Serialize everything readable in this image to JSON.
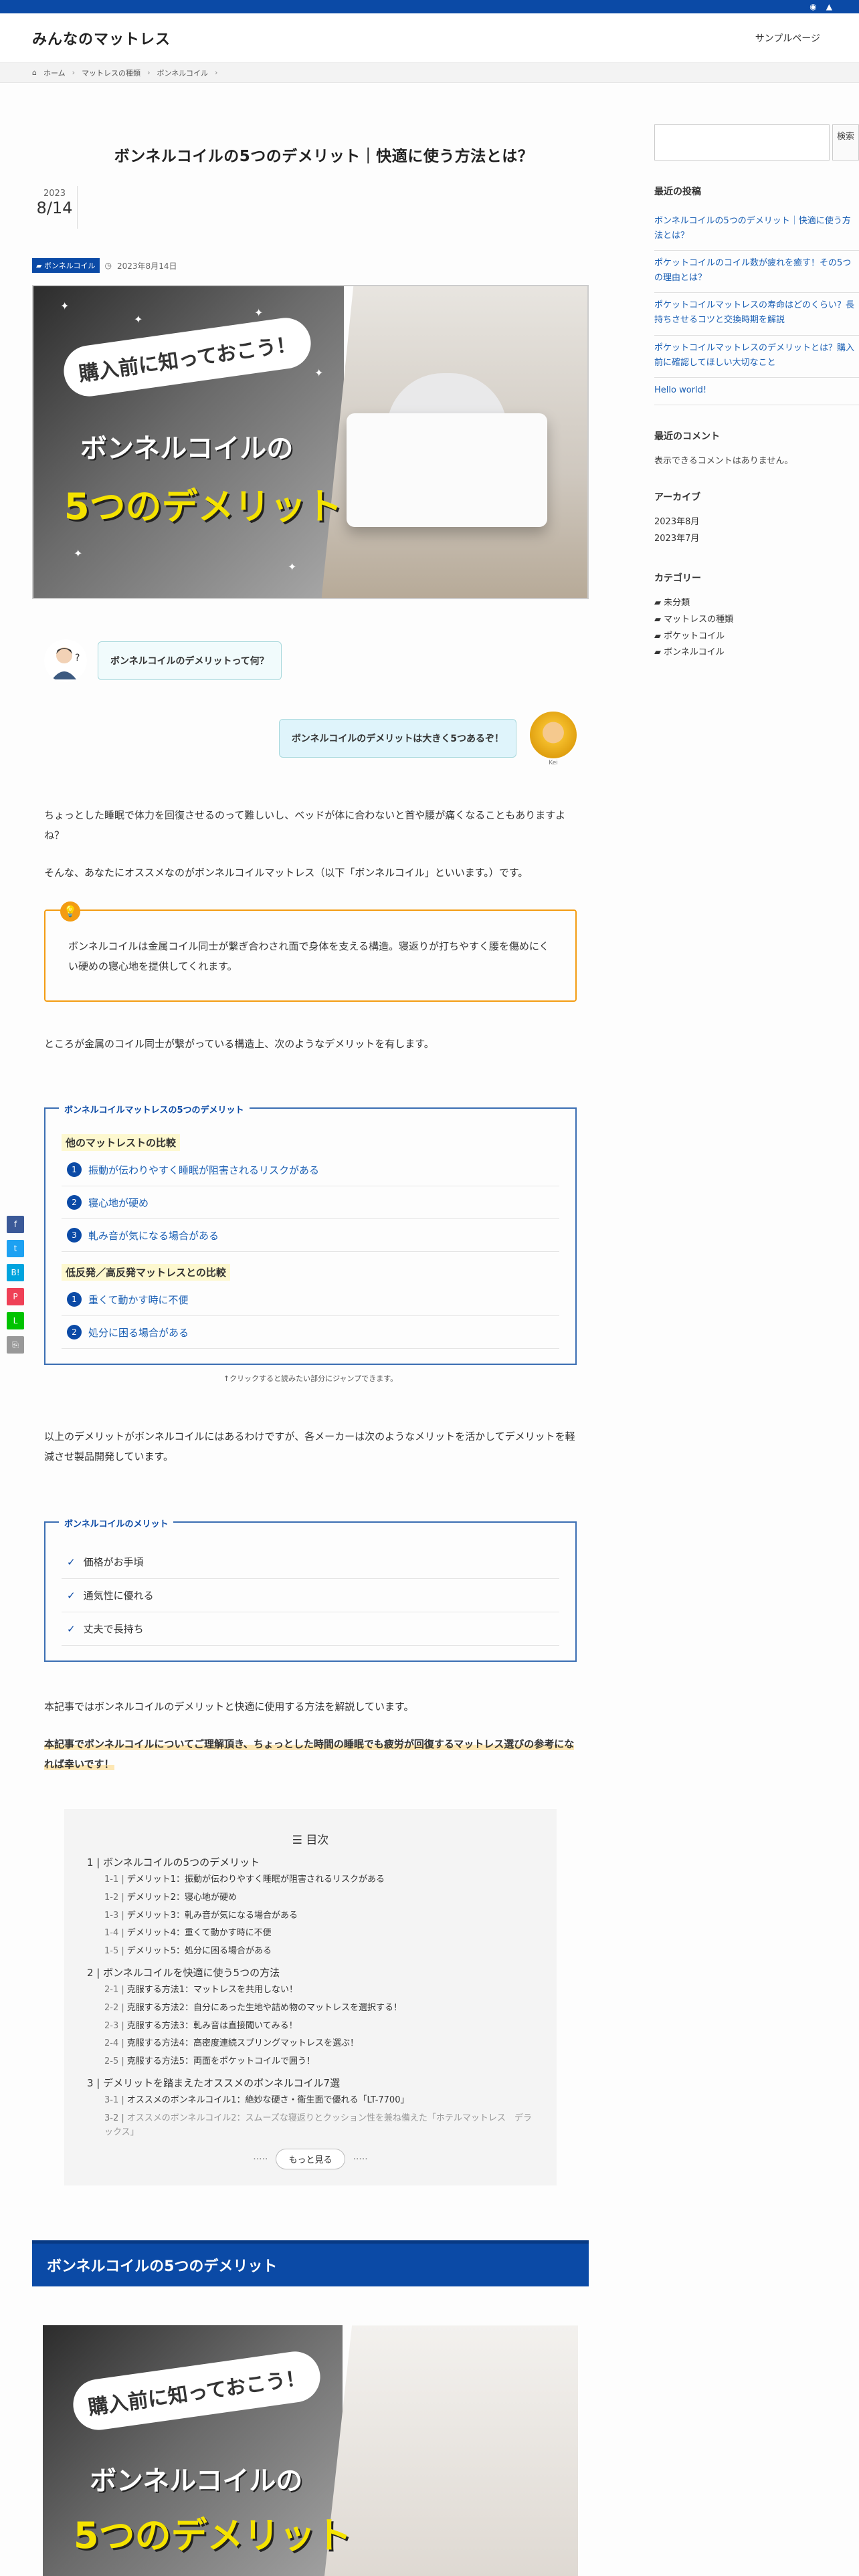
{
  "topbar": {
    "rss_icon": "rss-icon",
    "feedly_icon": "feedly-icon"
  },
  "header": {
    "site_title": "みんなのマットレス",
    "nav_item": "サンプルページ"
  },
  "breadcrumb": {
    "home": "ホーム",
    "cat1": "マットレスの種類",
    "cat2": "ボンネルコイル"
  },
  "post": {
    "title": "ボンネルコイルの5つのデメリット｜快適に使う方法とは？",
    "date_year": "2023",
    "date_md": "8/14",
    "category": "ボンネルコイル",
    "published": "2023年8月14日"
  },
  "eyecatch": {
    "sub": "購入前に知っておこう！",
    "line1": "ボンネルコイルの",
    "line2": "5つのデメリット"
  },
  "chat": {
    "q": "ボンネルコイルのデメリットって何？",
    "a": "ボンネルコイルのデメリットは大きく5つあるぞ！",
    "name": "Kei"
  },
  "body": {
    "p1": "ちょっとした睡眠で体力を回復させるのって難しいし、ベッドが体に合わないと首や腰が痛くなることもありますよね？",
    "p2": "そんな、あなたにオススメなのがボンネルコイルマットレス（以下「ボンネルコイル」といいます。）です。",
    "note": "ボンネルコイルは金属コイル同士が繋ぎ合わされ面で身体を支える構造。寝返りが打ちやすく腰を傷めにくい硬めの寝心地を提供してくれます。",
    "p3": "ところが金属のコイル同士が繋がっている構造上、次のようなデメリットを有します。",
    "p4": "以上のデメリットがボンネルコイルにはあるわけですが、各メーカーは次のようなメリットを活かしてデメリットを軽減させ製品開発しています。",
    "p5": "本記事ではボンネルコイルのデメリットと快適に使用する方法を解説しています。",
    "p6": "本記事でボンネルコイルについてご理解頂き、ちょっとした時間の睡眠でも疲労が回復するマットレス選びの参考になれば幸いです！"
  },
  "demerit_box": {
    "title": "ボンネルコイルマットレスの5つのデメリット",
    "group1": "他のマットレストの比較",
    "group1_items": [
      "振動が伝わりやすく睡眠が阻害されるリスクがある",
      "寝心地が硬め",
      "軋み音が気になる場合がある"
    ],
    "group2": "低反発／高反発マットレスとの比較",
    "group2_items": [
      "重くて動かす時に不便",
      "処分に困る場合がある"
    ],
    "caption": "↑クリックすると読みたい部分にジャンプできます。"
  },
  "merit_box": {
    "title": "ボンネルコイルのメリット",
    "items": [
      "価格がお手頃",
      "通気性に優れる",
      "丈夫で長持ち"
    ]
  },
  "toc": {
    "title": "目次",
    "sections": [
      {
        "num": "1",
        "label": "ボンネルコイルの5つのデメリット",
        "children": [
          {
            "num": "1-1",
            "label": "デメリット1：振動が伝わりやすく睡眠が阻害されるリスクがある"
          },
          {
            "num": "1-2",
            "label": "デメリット2：寝心地が硬め"
          },
          {
            "num": "1-3",
            "label": "デメリット3：軋み音が気になる場合がある"
          },
          {
            "num": "1-4",
            "label": "デメリット4：重くて動かす時に不便"
          },
          {
            "num": "1-5",
            "label": "デメリット5：処分に困る場合がある"
          }
        ]
      },
      {
        "num": "2",
        "label": "ボンネルコイルを快適に使う5つの方法",
        "children": [
          {
            "num": "2-1",
            "label": "克服する方法1：マットレスを共用しない！"
          },
          {
            "num": "2-2",
            "label": "克服する方法2：自分にあった生地や詰め物のマットレスを選択する！"
          },
          {
            "num": "2-3",
            "label": "克服する方法3：軋み音は直接聞いてみる！"
          },
          {
            "num": "2-4",
            "label": "克服する方法4：高密度連続スプリングマットレスを選ぶ！"
          },
          {
            "num": "2-5",
            "label": "克服する方法5：両面をポケットコイルで囲う！"
          }
        ]
      },
      {
        "num": "3",
        "label": "デメリットを踏まえたオススメのボンネルコイル7選",
        "children": [
          {
            "num": "3-1",
            "label": "オススメのボンネルコイル1：絶妙な硬さ・衛生面で優れる「LT-7700」"
          },
          {
            "num": "3-2",
            "label": "オススメのボンネルコイル2：スムーズな寝返りとクッション性を兼ね備えた「ホテルマットレス　デラックス」"
          }
        ]
      }
    ],
    "more": "もっと見る"
  },
  "section_h2": "ボンネルコイルの5つのデメリット",
  "sidebar": {
    "search_btn": "検索",
    "recent_title": "最近の投稿",
    "recent_posts": [
      "ボンネルコイルの5つのデメリット｜快適に使う方法とは？",
      "ポケットコイルのコイル数が疲れを癒す！その5つの理由とは？",
      "ポケットコイルマットレスの寿命はどのくらい？長持ちさせるコツと交換時期を解説",
      "ポケットコイルマットレスのデメリットとは？購入前に確認してほしい大切なこと",
      "Hello world!"
    ],
    "comments_title": "最近のコメント",
    "comments_text": "表示できるコメントはありません。",
    "archive_title": "アーカイブ",
    "archives": [
      "2023年8月",
      "2023年7月"
    ],
    "category_title": "カテゴリー",
    "categories": [
      "未分類",
      "マットレスの種類",
      "ポケットコイル",
      "ボンネルコイル"
    ]
  },
  "share": {
    "facebook": "f",
    "twitter": "t",
    "hatena": "B!",
    "pocket": "P",
    "line": "L",
    "copy": "⎘"
  }
}
